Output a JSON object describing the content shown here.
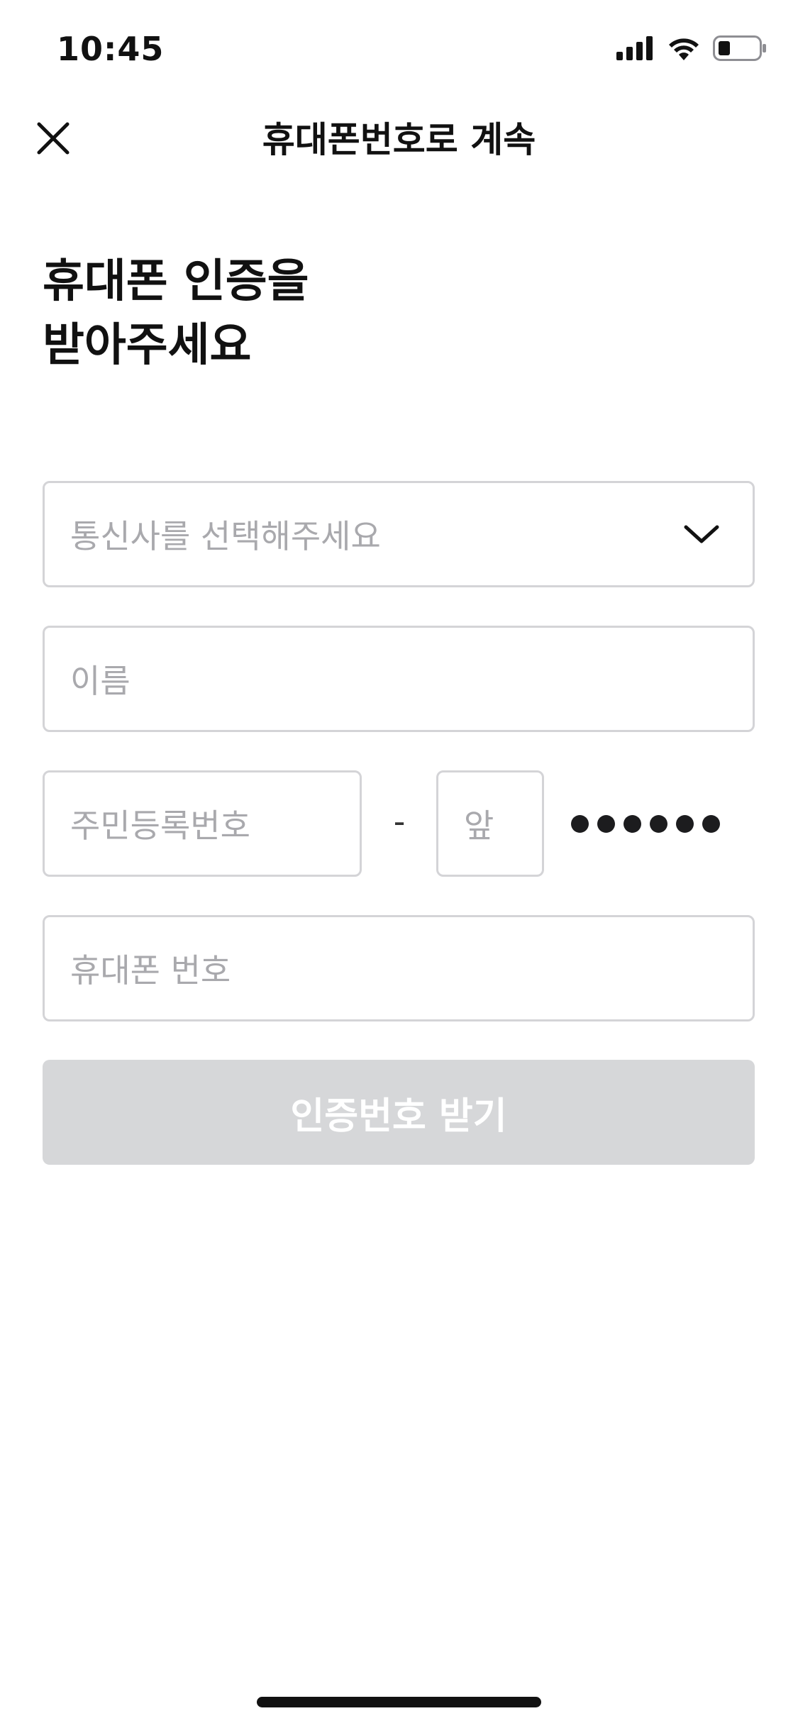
{
  "status_bar": {
    "time": "10:45",
    "icons": [
      "cellular-signal-icon",
      "wifi-icon",
      "battery-icon"
    ]
  },
  "header": {
    "title": "휴대폰번호로 계속",
    "close_icon": "close-icon"
  },
  "heading": {
    "line1": "휴대폰 인증을",
    "line2": "받아주세요"
  },
  "form": {
    "carrier": {
      "placeholder": "통신사를 선택해주세요",
      "icon": "chevron-down-icon"
    },
    "name": {
      "placeholder": "이름",
      "value": ""
    },
    "rrn": {
      "front_placeholder": "주민등록번호",
      "separator": "-",
      "back_placeholder": "앞",
      "masked_digits": 6
    },
    "phone": {
      "placeholder": "휴대폰 번호",
      "value": ""
    }
  },
  "submit": {
    "label": "인증번호 받기",
    "enabled": false
  },
  "colors": {
    "border": "#d4d4d7",
    "placeholder": "#a9a9ad",
    "button_disabled_bg": "#d6d7d9",
    "button_text": "#ffffff",
    "text_primary": "#111111"
  }
}
